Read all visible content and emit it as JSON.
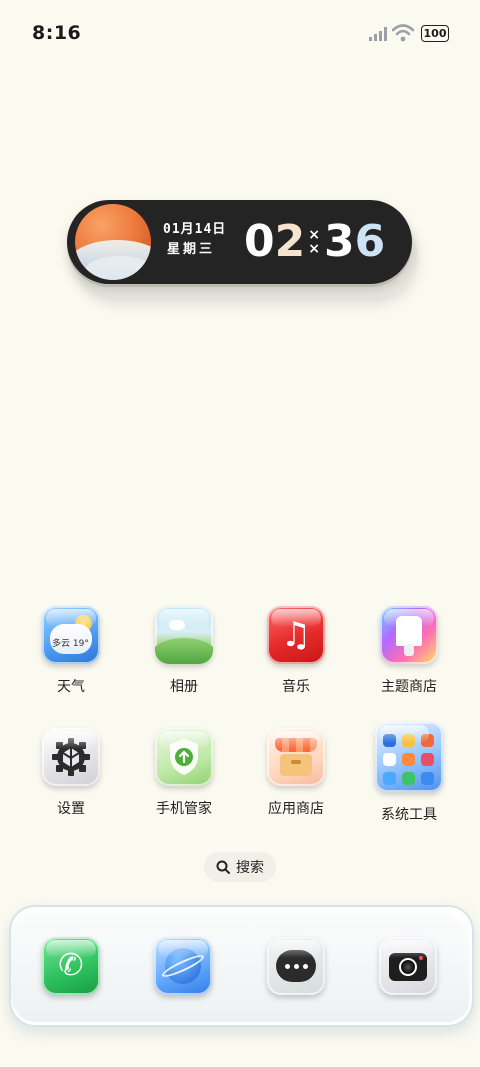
{
  "status_bar": {
    "time": "8:16",
    "battery": "100",
    "icons": [
      "signal-icon",
      "wifi-icon",
      "battery-icon"
    ]
  },
  "clock_widget": {
    "date": "01月14日",
    "weekday": "星期三",
    "hour_tens": "0",
    "hour_ones": "2",
    "separator_top": "×",
    "separator_bottom": "×",
    "minute_tens": "3",
    "minute_ones": "6"
  },
  "apps": {
    "weather": {
      "label": "天气",
      "tile_text": "多云 19°",
      "icon": "weather-icon"
    },
    "photos": {
      "label": "相册",
      "icon": "photos-icon"
    },
    "music": {
      "label": "音乐",
      "icon": "music-icon"
    },
    "themes": {
      "label": "主题商店",
      "icon": "theme-store-icon"
    },
    "settings": {
      "label": "设置",
      "icon": "gear-icon"
    },
    "security": {
      "label": "手机管家",
      "icon": "shield-icon"
    },
    "app_store": {
      "label": "应用商店",
      "icon": "store-icon"
    },
    "tools": {
      "label": "系统工具",
      "icon": "folder-icon"
    }
  },
  "search": {
    "label": "搜索"
  },
  "dock": [
    "phone-icon",
    "browser-icon",
    "messages-icon",
    "camera-icon"
  ],
  "colors": {
    "background": "#fbfaf1",
    "widget": "#242424",
    "accent_orange": "#ee7b3d"
  }
}
